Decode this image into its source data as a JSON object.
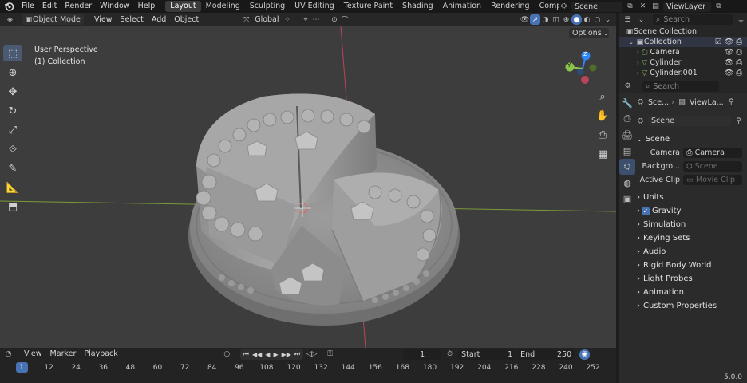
{
  "menubar": {
    "items": [
      "File",
      "Edit",
      "Render",
      "Window",
      "Help"
    ],
    "workspaces": [
      "Layout",
      "Modeling",
      "Sculpting",
      "UV Editing",
      "Texture Paint",
      "Shading",
      "Animation",
      "Rendering",
      "Compositing"
    ],
    "scene": "Scene",
    "view_layer": "ViewLayer"
  },
  "viewport_header": {
    "mode": "Object Mode",
    "menus": [
      "View",
      "Select",
      "Add",
      "Object"
    ],
    "orientation": "Global",
    "options": "Options"
  },
  "viewport": {
    "perspective": "User Perspective",
    "collection": "(1) Collection",
    "gizmo": {
      "x": "X",
      "y": "Y",
      "z": "Z"
    }
  },
  "outliner": {
    "search_placeholder": "Search",
    "root": "Scene Collection",
    "collection": "Collection",
    "items": [
      "Camera",
      "Cylinder",
      "Cylinder.001"
    ]
  },
  "properties": {
    "search_placeholder": "Search",
    "breadcrumb": [
      "Sce...",
      "ViewLa..."
    ],
    "datablock": "Scene",
    "panel_title": "Scene",
    "fields": [
      {
        "label": "Camera",
        "value": "Camera",
        "dim": false
      },
      {
        "label": "Backgro...",
        "value": "Scene",
        "dim": true
      },
      {
        "label": "Active Clip",
        "value": "Movie Clip",
        "dim": true
      }
    ],
    "subpanels": [
      "Units",
      "Gravity",
      "Simulation",
      "Keying Sets",
      "Audio",
      "Rigid Body World",
      "Light Probes",
      "Animation",
      "Custom Properties"
    ],
    "gravity_checked": true
  },
  "timeline": {
    "menus": [
      "View",
      "Marker",
      "Playback"
    ],
    "current_frame": "1",
    "start_label": "Start",
    "start": "1",
    "end_label": "End",
    "end": "250",
    "ruler": [
      "1",
      "12",
      "24",
      "36",
      "48",
      "60",
      "72",
      "84",
      "96",
      "108",
      "120",
      "132",
      "144",
      "156",
      "168",
      "180",
      "192",
      "204",
      "216",
      "228",
      "240",
      "252"
    ]
  },
  "status": {
    "version": "5.0.0"
  },
  "colors": {
    "accent": "#4772b3",
    "x_axis": "#e8485e",
    "y_axis": "#8bc34a",
    "z_axis": "#2f86f6"
  }
}
